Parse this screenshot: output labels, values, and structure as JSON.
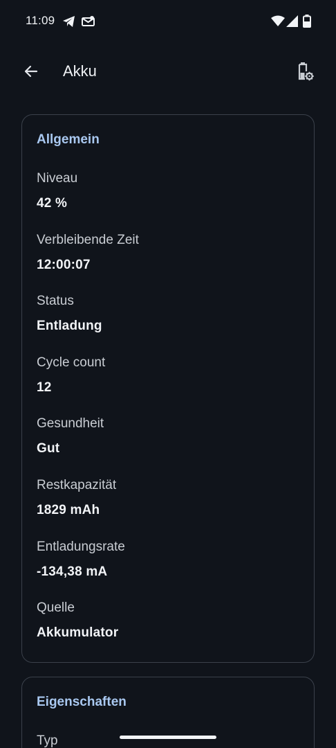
{
  "status_bar": {
    "time": "11:09",
    "icons": [
      "telegram-icon",
      "notification-icon",
      "wifi-icon",
      "signal-icon",
      "battery-icon"
    ]
  },
  "app_bar": {
    "title": "Akku",
    "back_icon": "arrow-left-icon",
    "action_icon": "battery-settings-icon"
  },
  "general": {
    "title": "Allgemein",
    "items": [
      {
        "label": "Niveau",
        "value": "42 %"
      },
      {
        "label": "Verbleibende Zeit",
        "value": "12:00:07"
      },
      {
        "label": "Status",
        "value": "Entladung"
      },
      {
        "label": "Cycle count",
        "value": "12"
      },
      {
        "label": "Gesundheit",
        "value": "Gut"
      },
      {
        "label": "Restkapazität",
        "value": "1829 mAh"
      },
      {
        "label": "Entladungsrate",
        "value": "-134,38 mA"
      },
      {
        "label": "Quelle",
        "value": "Akkumulator"
      }
    ]
  },
  "properties": {
    "title": "Eigenschaften",
    "items": [
      {
        "label": "Typ"
      }
    ]
  },
  "colors": {
    "background": "#10141b",
    "accent": "#a9c8f0",
    "card_border": "#3b414b"
  }
}
